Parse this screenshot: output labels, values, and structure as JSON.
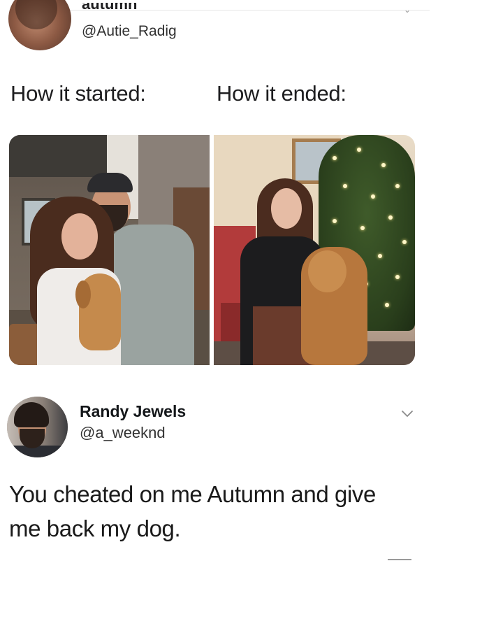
{
  "tweet_top": {
    "name_clipped": "autumn",
    "handle": "@Autie_Radig",
    "caption_left": "How it started:",
    "caption_right": "How it ended:",
    "menu_icon": "chevron-down-icon"
  },
  "photos": {
    "left_description_icon": "couple-with-puppy-photo",
    "right_description_icon": "woman-with-dog-christmas-photo"
  },
  "tweet_reply": {
    "name": "Randy Jewels",
    "handle": "@a_weeknd",
    "text_line1": "You cheated on me Autumn and give",
    "text_line2": "me back my dog.",
    "menu_icon": "chevron-down-icon"
  }
}
